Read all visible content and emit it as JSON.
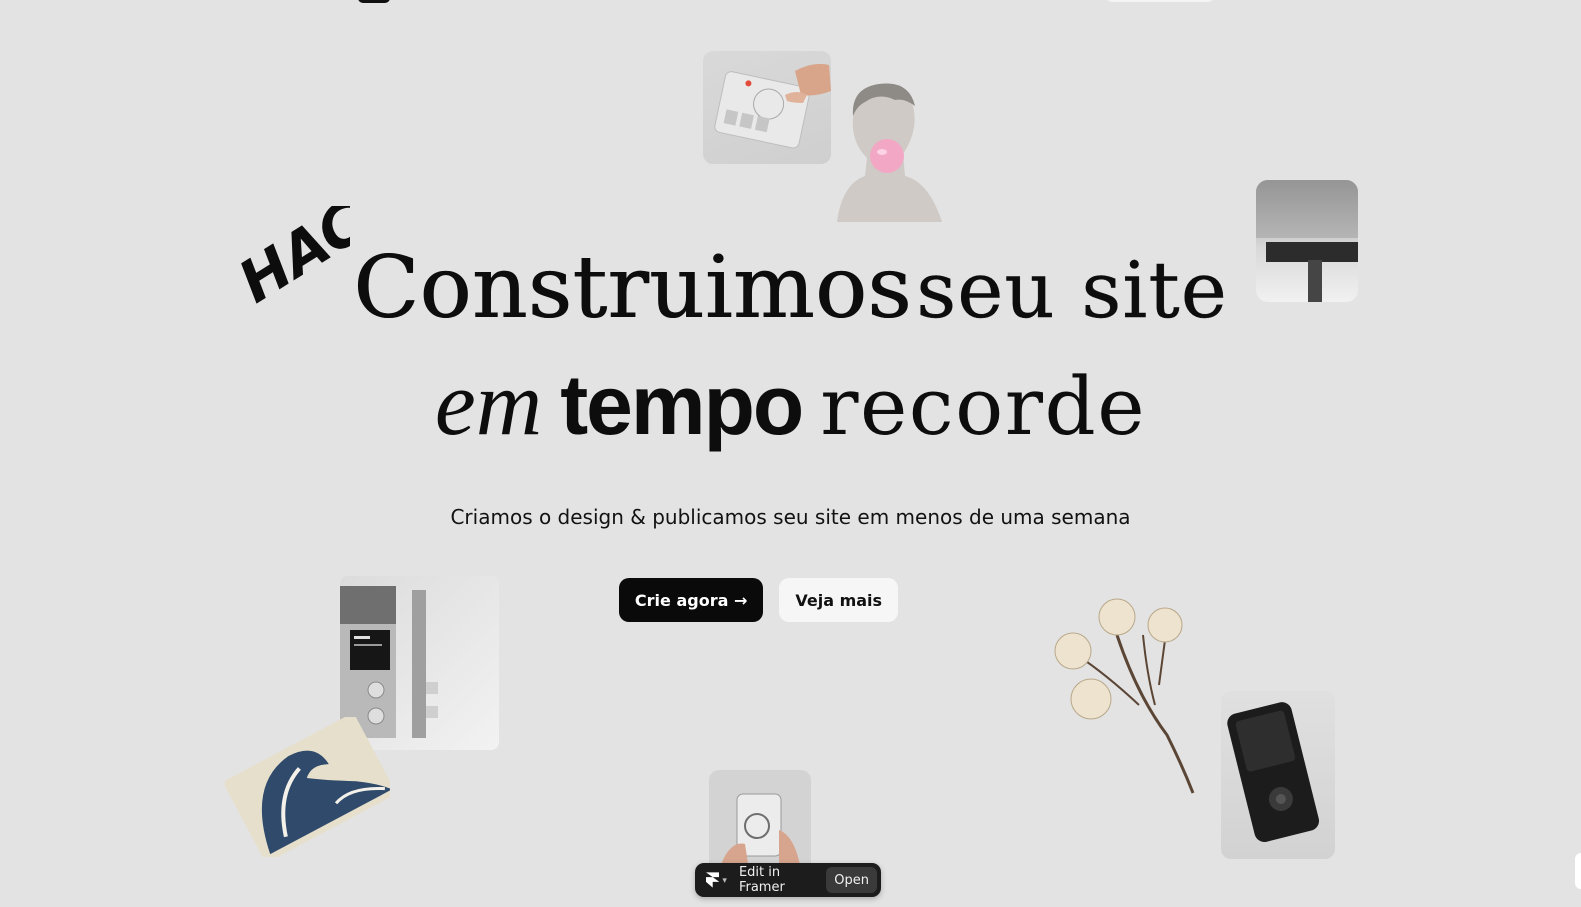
{
  "hero": {
    "line1_a": "Construimos",
    "line1_b": "seu site",
    "line2_a": "em",
    "line2_b": "tempo",
    "line2_c": "recorde",
    "subtitle": "Criamos o design & publicamos seu site em menos de uma semana"
  },
  "logo": {
    "text": "HAC"
  },
  "cta": {
    "primary_label": "Crie agora →",
    "secondary_label": "Veja mais"
  },
  "framer_badge": {
    "edit_label": "Edit in Framer",
    "open_label": "Open"
  },
  "colors": {
    "background": "#e3e3e3",
    "primary_button": "#0a0a0a",
    "secondary_button": "#f6f6f6",
    "text": "#0d0d0d"
  },
  "icons": {
    "framer": "framer-logo-icon",
    "chevron": "chevron-down-icon"
  }
}
